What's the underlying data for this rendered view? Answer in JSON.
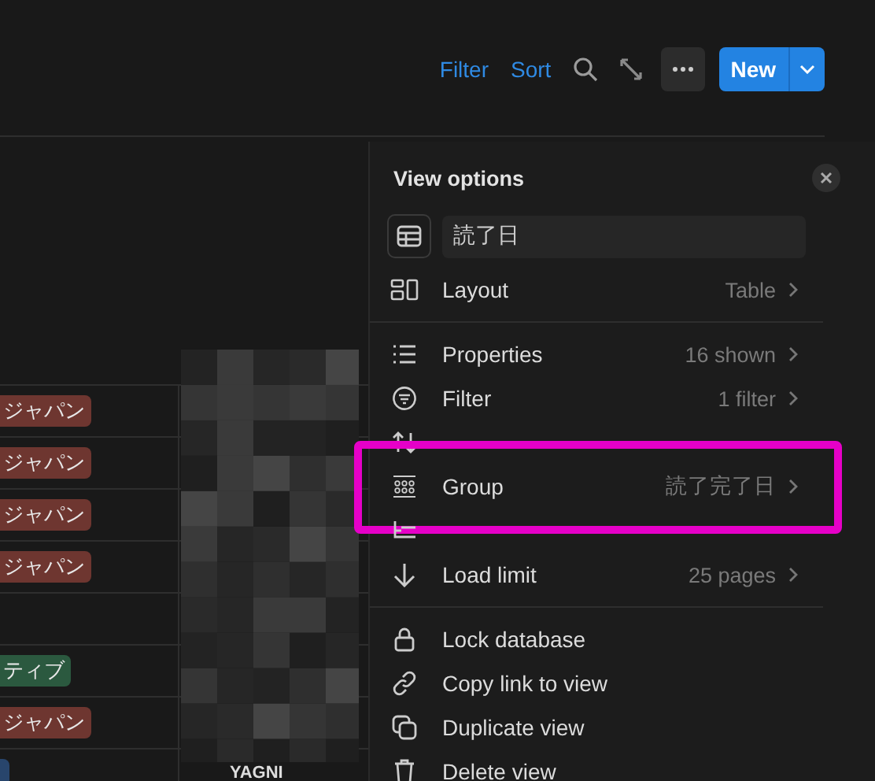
{
  "toolbar": {
    "links": [
      "Filter",
      "Sort"
    ],
    "new_button": "New"
  },
  "table": {
    "rows": [
      {
        "tag": {
          "label": "ジャパン",
          "color": "#6e3630"
        }
      },
      {
        "tag": {
          "label": "ジャパン",
          "color": "#6e3630"
        }
      },
      {
        "tag": {
          "label": "ジャパン",
          "color": "#6e3630"
        }
      },
      {
        "tag": {
          "label": "ジャパン",
          "color": "#6e3630"
        }
      },
      {},
      {
        "tag": {
          "label": "ティブ",
          "color": "#2b593f"
        }
      },
      {
        "tag": {
          "label": "ジャパン",
          "color": "#6e3630"
        }
      },
      {
        "tag": {
          "color": "#28456c"
        },
        "page": "YAGNI"
      }
    ]
  },
  "view_options": {
    "title": "View options",
    "view_name": "読了日",
    "sections": [
      [
        {
          "label": "Layout",
          "value": "Table",
          "highlighted": false
        }
      ],
      [
        {
          "label": "Properties",
          "value": "16 shown",
          "highlighted": false
        },
        {
          "label": "Filter",
          "value": "1 filter",
          "highlighted": false
        },
        {
          "highlighted": false
        },
        {
          "label": "Group",
          "value": "読了完了日",
          "highlighted": true
        },
        {
          "highlighted": false
        },
        {
          "label": "Load limit",
          "value": "25 pages",
          "highlighted": false
        }
      ],
      [
        {
          "label": "Lock database",
          "highlighted": false
        },
        {
          "label": "Copy link to view",
          "highlighted": false
        },
        {
          "label": "Duplicate view",
          "highlighted": false
        },
        {
          "label": "Delete view",
          "highlighted": false
        }
      ]
    ]
  }
}
